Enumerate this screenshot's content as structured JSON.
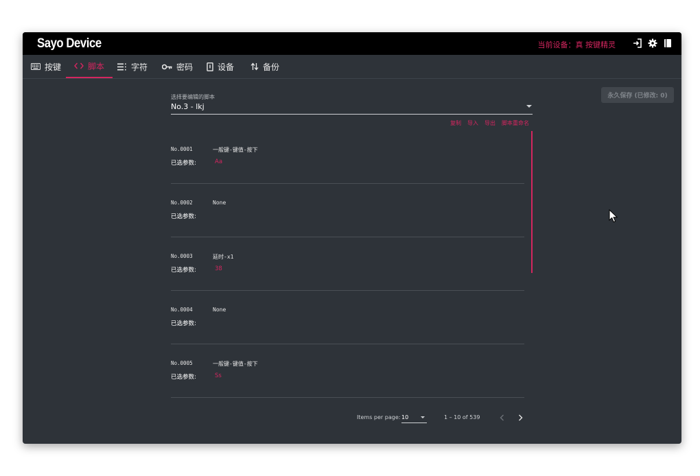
{
  "app": {
    "title": "Sayo Device"
  },
  "header": {
    "current_device": "当前设备：真 按键精灵"
  },
  "top_icons": [
    "login-icon",
    "gear-icon",
    "book-icon"
  ],
  "tabs": [
    {
      "label": "按键",
      "icon": "keyboard-icon"
    },
    {
      "label": "脚本",
      "icon": "code-icon",
      "active": true
    },
    {
      "label": "字符",
      "icon": "list-icon"
    },
    {
      "label": "密码",
      "icon": "key-icon"
    },
    {
      "label": "设备",
      "icon": "device-icon"
    },
    {
      "label": "备份",
      "icon": "swap-icon"
    }
  ],
  "save_button": {
    "label": "永久保存 (已修改: 0)"
  },
  "script_select": {
    "label": "选择要编辑的脚本",
    "value": "No.3 - lkj"
  },
  "actions": [
    "复制",
    "导入",
    "导出",
    "脚本重命名"
  ],
  "items": [
    {
      "num": "No.0001",
      "name": "一般键-键值-按下",
      "param_label": "已选参数:",
      "param_value": "Aa"
    },
    {
      "num": "No.0002",
      "name": "None",
      "param_label": "已选参数:",
      "param_value": ""
    },
    {
      "num": "No.0003",
      "name": "延时-x1",
      "param_label": "已选参数:",
      "param_value": "38"
    },
    {
      "num": "No.0004",
      "name": "None",
      "param_label": "已选参数:",
      "param_value": ""
    },
    {
      "num": "No.0005",
      "name": "一般键-键值-按下",
      "param_label": "已选参数:",
      "param_value": "Ss"
    }
  ],
  "pager": {
    "items_per_page_label": "Items per page:",
    "page_size": "10",
    "range": "1 – 10 of 539"
  },
  "colors": {
    "accent": "#d4265f",
    "background": "#2e3339",
    "topbar": "#000000"
  }
}
